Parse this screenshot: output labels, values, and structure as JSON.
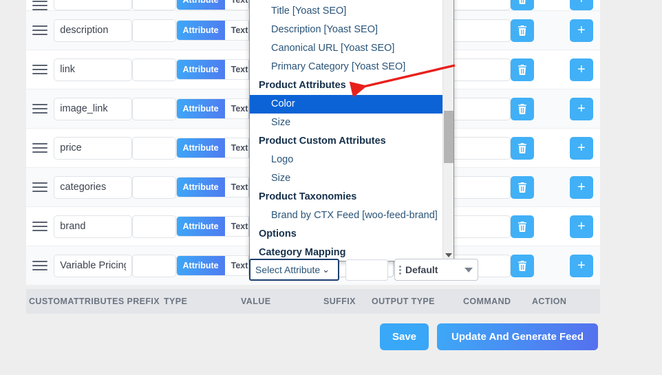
{
  "table": {
    "columns": [
      {
        "key": "customattributes",
        "label": "CUSTOMATTRIBUTES"
      },
      {
        "key": "prefix",
        "label": "PREFIX"
      },
      {
        "key": "type",
        "label": "TYPE"
      },
      {
        "key": "value",
        "label": "VALUE"
      },
      {
        "key": "suffix",
        "label": "SUFFIX"
      },
      {
        "key": "output_type",
        "label": "OUTPUT TYPE"
      },
      {
        "key": "command",
        "label": "COMMAND"
      },
      {
        "key": "action",
        "label": "ACTION"
      }
    ],
    "type_toggle": {
      "attribute_label": "Attribute",
      "text_label": "Text",
      "active": "Attribute"
    },
    "rows": [
      {
        "name": "",
        "prefix": "",
        "type": "Attribute",
        "value": "",
        "suffix": "",
        "clipped": true
      },
      {
        "name": "description",
        "prefix": "",
        "type": "Attribute",
        "value": "",
        "suffix": ""
      },
      {
        "name": "link",
        "prefix": "",
        "type": "Attribute",
        "value": "",
        "suffix": ""
      },
      {
        "name": "image_link",
        "prefix": "",
        "type": "Attribute",
        "value": "",
        "suffix": ""
      },
      {
        "name": "price",
        "prefix": "",
        "type": "Attribute",
        "value": "",
        "suffix": ""
      },
      {
        "name": "categories",
        "prefix": "",
        "type": "Attribute",
        "value": "",
        "suffix": ""
      },
      {
        "name": "brand",
        "prefix": "",
        "type": "Attribute",
        "value": "",
        "suffix": ""
      },
      {
        "name": "Variable Pricing",
        "prefix": "",
        "type": "Attribute",
        "value": "",
        "suffix": ""
      }
    ],
    "delete_icon": "trash-icon",
    "add_icon": "plus-icon",
    "drag_icon": "drag-handle-icon"
  },
  "edit_row": {
    "select_attribute_label": "Select Attribute",
    "chevron": "⌄",
    "suffix_value": "",
    "output_type_value": "Default"
  },
  "dropdown": {
    "selected": "Color",
    "items": [
      {
        "label": "Title [Yoast SEO]",
        "group": false
      },
      {
        "label": "Description [Yoast SEO]",
        "group": false
      },
      {
        "label": "Canonical URL [Yoast SEO]",
        "group": false
      },
      {
        "label": "Primary Category [Yoast SEO]",
        "group": false
      },
      {
        "label": "Product Attributes",
        "group": true
      },
      {
        "label": "Color",
        "group": false
      },
      {
        "label": "Size",
        "group": false
      },
      {
        "label": "Product Custom Attributes",
        "group": true
      },
      {
        "label": "Logo",
        "group": false
      },
      {
        "label": "Size",
        "group": false
      },
      {
        "label": "Product Taxonomies",
        "group": true
      },
      {
        "label": "Brand by CTX Feed [woo-feed-brand]",
        "group": false
      },
      {
        "label": "Options",
        "group": true
      },
      {
        "label": "Category Mapping",
        "group": true
      }
    ]
  },
  "footer": {
    "save_label": "Save",
    "update_label": "Update And Generate Feed"
  },
  "colors": {
    "accent_blue": "#41b0f7",
    "gradient_end": "#5570ee",
    "highlight_blue": "#0b63d6",
    "annotation_red": "#e8201c",
    "header_strip": "#e3e5e9",
    "page_bg": "#eeeeee"
  }
}
